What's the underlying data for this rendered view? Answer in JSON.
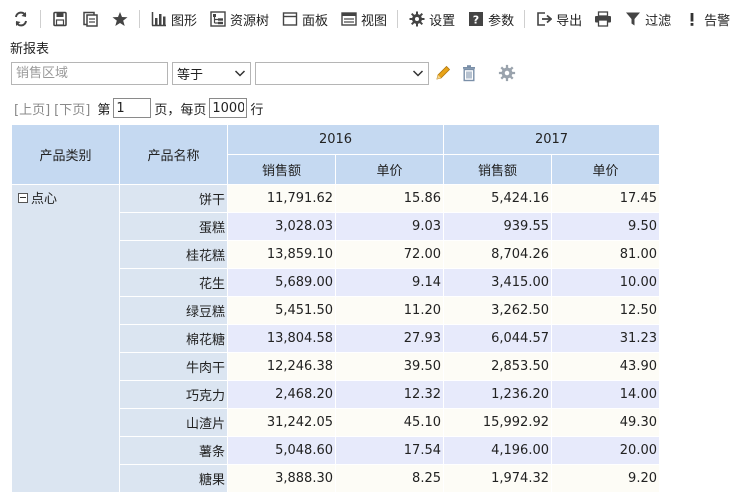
{
  "toolbar": {
    "chart": "图形",
    "resource_tree": "资源树",
    "panel": "面板",
    "view": "视图",
    "settings": "设置",
    "params": "参数",
    "export": "导出",
    "filter": "过滤",
    "alert": "告警"
  },
  "report": {
    "title": "新报表"
  },
  "filter": {
    "field_placeholder": "销售区域",
    "operator": "等于",
    "value": ""
  },
  "pager": {
    "prev": "[上页]",
    "next": "[下页]",
    "page_prefix": "第",
    "page_value": "1",
    "page_suffix": "页，每页",
    "size_value": "1000",
    "size_suffix": "行"
  },
  "table": {
    "headers": {
      "category": "产品类别",
      "product": "产品名称",
      "year1": "2016",
      "year2": "2017",
      "sales": "销售额",
      "price": "单价"
    },
    "category": "点心",
    "rows": [
      {
        "name": "饼干",
        "s2016": "11,791.62",
        "p2016": "15.86",
        "s2017": "5,424.16",
        "p2017": "17.45"
      },
      {
        "name": "蛋糕",
        "s2016": "3,028.03",
        "p2016": "9.03",
        "s2017": "939.55",
        "p2017": "9.50"
      },
      {
        "name": "桂花糕",
        "s2016": "13,859.10",
        "p2016": "72.00",
        "s2017": "8,704.26",
        "p2017": "81.00"
      },
      {
        "name": "花生",
        "s2016": "5,689.00",
        "p2016": "9.14",
        "s2017": "3,415.00",
        "p2017": "10.00"
      },
      {
        "name": "绿豆糕",
        "s2016": "5,451.50",
        "p2016": "11.20",
        "s2017": "3,262.50",
        "p2017": "12.50"
      },
      {
        "name": "棉花糖",
        "s2016": "13,804.58",
        "p2016": "27.93",
        "s2017": "6,044.57",
        "p2017": "31.23"
      },
      {
        "name": "牛肉干",
        "s2016": "12,246.38",
        "p2016": "39.50",
        "s2017": "2,853.50",
        "p2017": "43.90"
      },
      {
        "name": "巧克力",
        "s2016": "2,468.20",
        "p2016": "12.32",
        "s2017": "1,236.20",
        "p2017": "14.00"
      },
      {
        "name": "山渣片",
        "s2016": "31,242.05",
        "p2016": "45.10",
        "s2017": "15,992.92",
        "p2017": "49.30"
      },
      {
        "name": "薯条",
        "s2016": "5,048.60",
        "p2016": "17.54",
        "s2017": "4,196.00",
        "p2017": "20.00"
      },
      {
        "name": "糖果",
        "s2016": "3,888.30",
        "p2016": "8.25",
        "s2017": "1,974.32",
        "p2017": "9.20"
      }
    ]
  },
  "colors": {
    "header_bg": "#c5d9f1",
    "dim_bg": "#dbe5f1",
    "row_odd": "#fdfcf6",
    "row_even": "#e7eafb",
    "pencil": "#e8a317",
    "trash": "#7a8fa8"
  },
  "icons": [
    "refresh-icon",
    "save-icon",
    "save-as-icon",
    "favorite-star-icon",
    "chart-icon",
    "resource-tree-icon",
    "panel-icon",
    "view-icon",
    "gear-icon",
    "help-icon",
    "export-icon",
    "print-icon",
    "filter-funnel-icon",
    "alert-exclamation-icon",
    "pencil-icon",
    "trash-icon",
    "filter-settings-gear-icon",
    "collapse-minus-icon",
    "chevron-down-icon"
  ]
}
